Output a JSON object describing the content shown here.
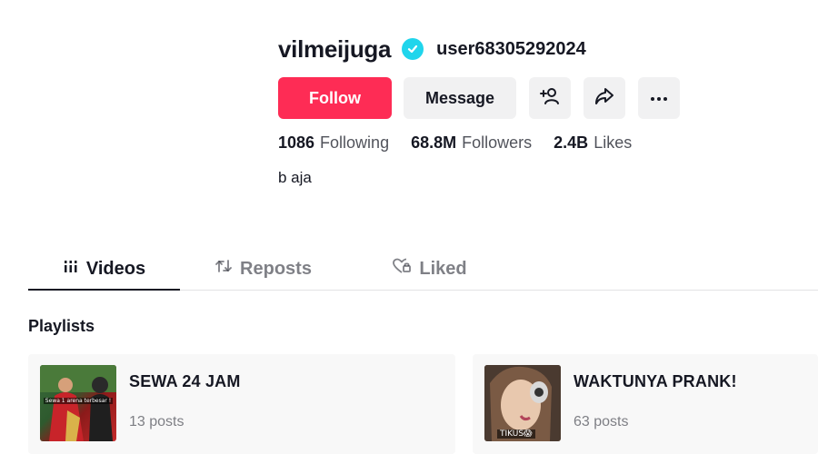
{
  "profile": {
    "username": "vilmeijuga",
    "handle": "user68305292024",
    "verified_icon": "verified-badge-icon",
    "bio": "b aja"
  },
  "actions": {
    "follow_label": "Follow",
    "message_label": "Message",
    "add_friend_icon": "add-user-icon",
    "share_icon": "share-icon",
    "more_icon": "more-options-icon"
  },
  "stats": {
    "following_count": "1086",
    "following_label": "Following",
    "followers_count": "68.8M",
    "followers_label": "Followers",
    "likes_count": "2.4B",
    "likes_label": "Likes"
  },
  "tabs": [
    {
      "label": "Videos",
      "icon": "grid-icon",
      "active": true
    },
    {
      "label": "Reposts",
      "icon": "repost-icon",
      "active": false
    },
    {
      "label": "Liked",
      "icon": "heart-lock-icon",
      "active": false
    }
  ],
  "playlists": {
    "title": "Playlists",
    "items": [
      {
        "title": "SEWA 24 JAM",
        "count": "13 posts",
        "thumb_caption": "Sewa 1 arena terbesar !"
      },
      {
        "title": "WAKTUNYA PRANK!",
        "count": "63 posts",
        "thumb_caption": "TIKUS😱"
      }
    ]
  },
  "colors": {
    "accent": "#fe2c55",
    "verified": "#20d5ec",
    "text": "#161823",
    "button_bg": "#f1f1f2"
  }
}
